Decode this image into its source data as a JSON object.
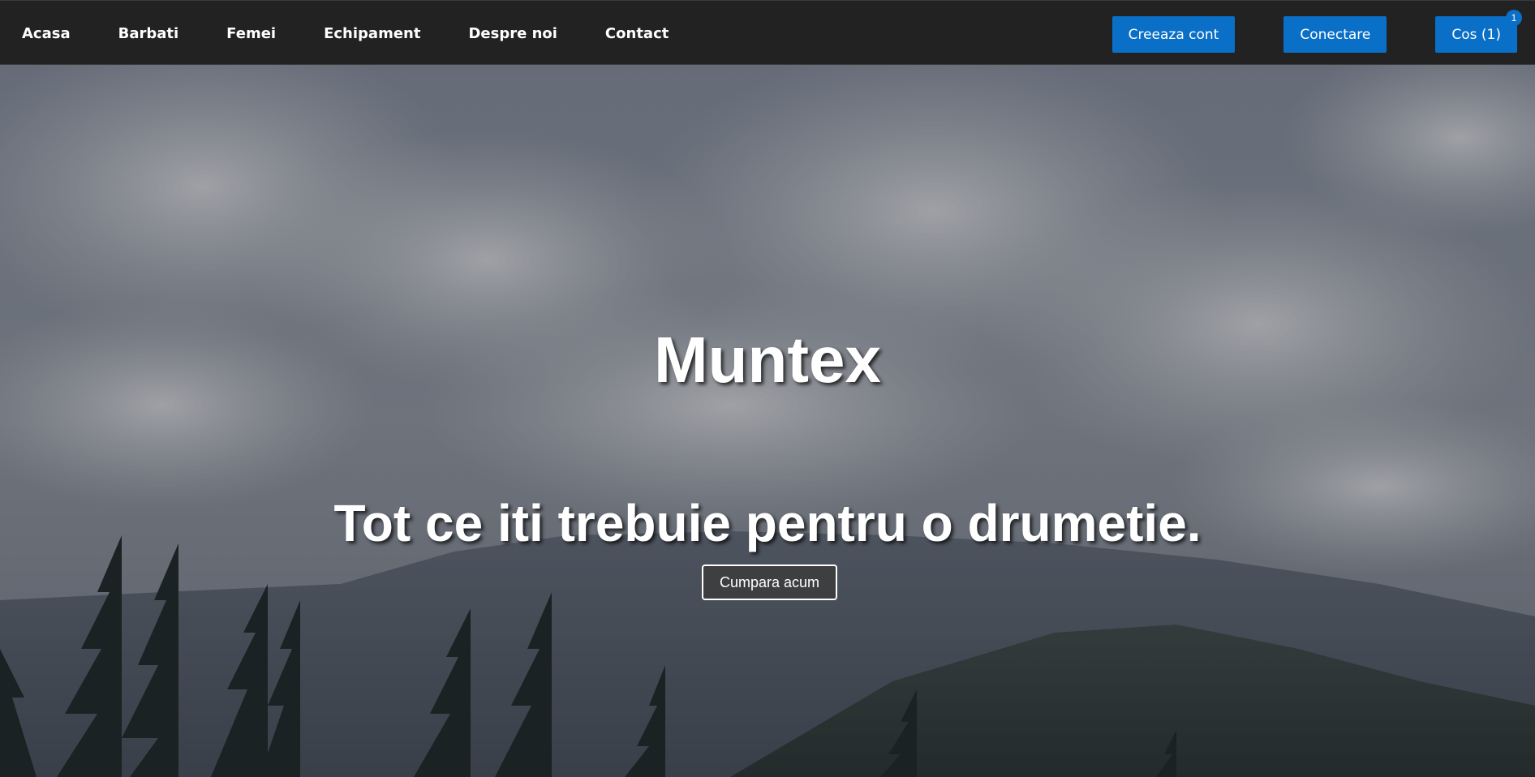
{
  "nav": {
    "links": [
      {
        "label": "Acasa"
      },
      {
        "label": "Barbati"
      },
      {
        "label": "Femei"
      },
      {
        "label": "Echipament"
      },
      {
        "label": "Despre noi"
      },
      {
        "label": "Contact"
      }
    ],
    "create_account_label": "Creeaza cont",
    "login_label": "Conectare",
    "cart_label": "Cos (1)",
    "cart_badge": "1"
  },
  "hero": {
    "title": "Muntex",
    "subtitle": "Tot ce iti trebuie pentru o drumetie.",
    "cta_label": "Cumpara acum",
    "background": "mountain-landscape-clouds"
  },
  "colors": {
    "navbar_bg": "#222222",
    "accent": "#0a6fc6",
    "text": "#ffffff"
  }
}
